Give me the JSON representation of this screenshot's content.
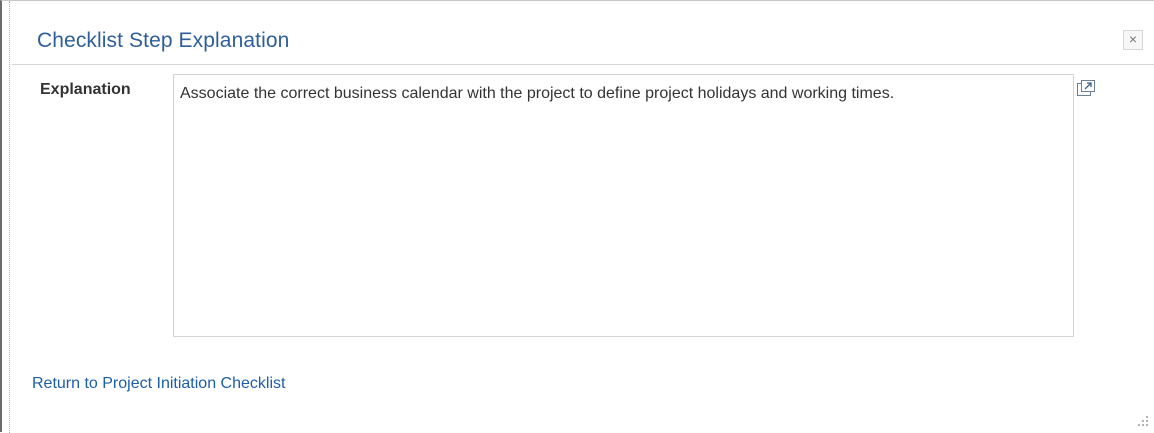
{
  "dialog": {
    "title": "Checklist Step Explanation",
    "close_label": "×",
    "close_icon": "close-icon"
  },
  "explanation": {
    "label": "Explanation",
    "value": "Associate the correct business calendar with the project to define project holidays and working times.",
    "expand_icon": "expand-window-icon"
  },
  "footer": {
    "return_link": "Return to Project Initiation Checklist",
    "resize_icon": "resize-grip-icon"
  },
  "colors": {
    "title": "#2e5f9a",
    "link": "#1e5da8",
    "text": "#333333"
  }
}
